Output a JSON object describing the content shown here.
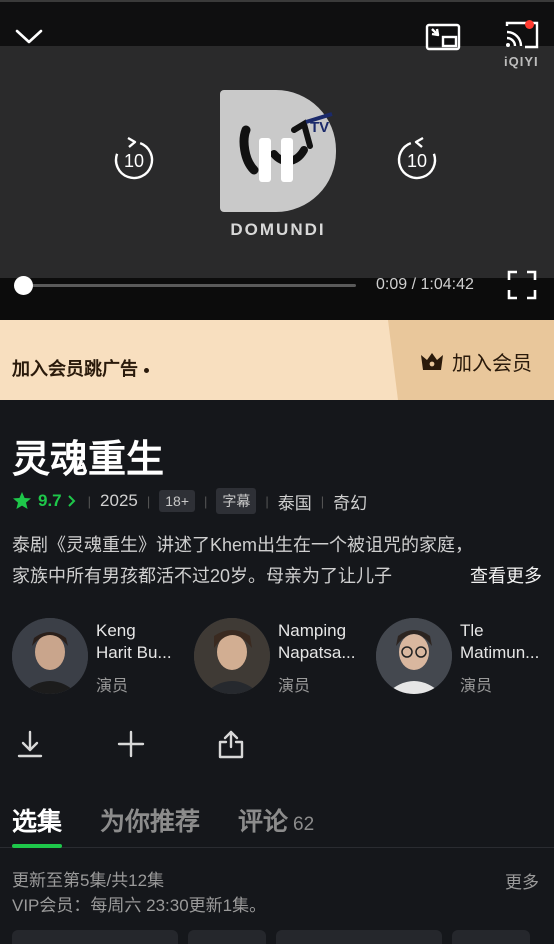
{
  "player": {
    "brand": "iQIYI",
    "logo_text": "DOMUNDI",
    "logo_badge": "TV",
    "seek_back_label": "10",
    "seek_forward_label": "10",
    "current_time": "0:09",
    "duration": "1:04:42",
    "time_separator": " / ",
    "progress_fraction": 0.002,
    "icons": [
      "chevron-down-icon",
      "picture-in-picture-icon",
      "cast-icon",
      "replay-10-icon",
      "pause-icon",
      "forward-10-icon",
      "fullscreen-icon"
    ]
  },
  "vip_banner": {
    "message": "加入会员跳广告",
    "button_label": "加入会员",
    "icon": "crown-icon"
  },
  "show": {
    "title": "灵魂重生",
    "rating": "9.7",
    "year": "2025",
    "age_rating": "18+",
    "subtitle_tag": "字幕",
    "country": "泰国",
    "genre": "奇幻",
    "description_line1": "泰剧《灵魂重生》讲述了Khem出生在一个被诅咒的家庭，",
    "description_line2": "家族中所有男孩都活不过20岁。母亲为了让儿子",
    "more_label": "查看更多"
  },
  "cast": [
    {
      "name_line1": "Keng",
      "name_line2": "Harit Bu...",
      "role": "演员"
    },
    {
      "name_line1": "Namping",
      "name_line2": "Napatsa...",
      "role": "演员"
    },
    {
      "name_line1": "Tle",
      "name_line2": "Matimun...",
      "role": "演员"
    }
  ],
  "actions": [
    "download-icon",
    "add-icon",
    "share-icon"
  ],
  "tabs": [
    {
      "label": "选集",
      "active": true
    },
    {
      "label": "为你推荐",
      "active": false
    },
    {
      "label": "评论",
      "count": "62",
      "active": false
    }
  ],
  "episodes": {
    "update_status": "更新至第5集/共12集",
    "schedule": "VIP会员：每周六 23:30更新1集。",
    "more_label": "更多"
  },
  "colors": {
    "accent": "#1ec74a",
    "background": "#15171b",
    "vip_banner": "#f8dfbf"
  }
}
